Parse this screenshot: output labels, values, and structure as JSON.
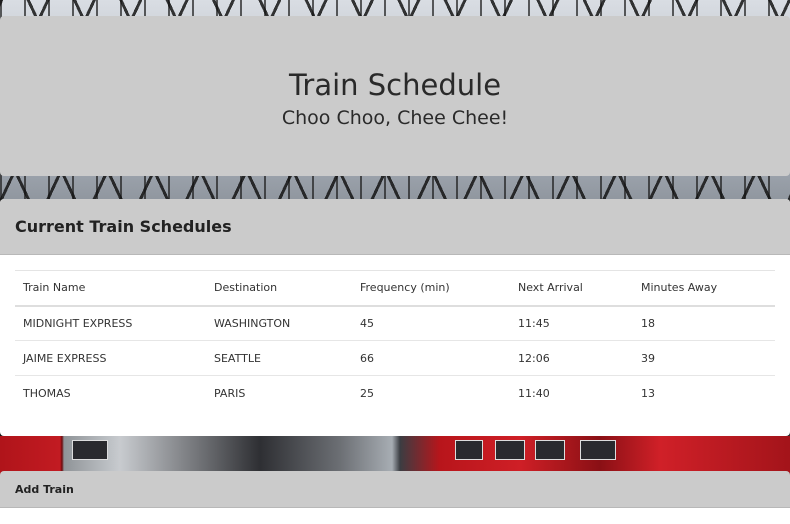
{
  "header": {
    "title": "Train Schedule",
    "subtitle": "Choo Choo, Chee Chee!"
  },
  "schedule": {
    "heading": "Current Train Schedules",
    "columns": [
      "Train Name",
      "Destination",
      "Frequency (min)",
      "Next Arrival",
      "Minutes Away"
    ],
    "rows": [
      [
        "MIDNIGHT EXPRESS",
        "WASHINGTON",
        "45",
        "11:45",
        "18"
      ],
      [
        "JAIME EXPRESS",
        "SEATTLE",
        "66",
        "12:06",
        "39"
      ],
      [
        "THOMAS",
        "PARIS",
        "25",
        "11:40",
        "13"
      ]
    ]
  },
  "add_train": {
    "heading": "Add Train"
  }
}
